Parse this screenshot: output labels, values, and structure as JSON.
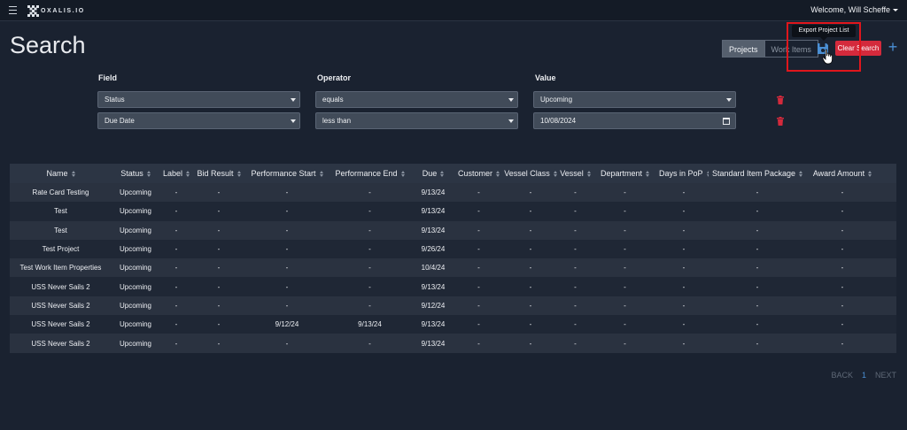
{
  "topbar": {
    "brand": "OXALIS.IO",
    "welcome": "Welcome, Will Scheffe"
  },
  "page": {
    "title": "Search"
  },
  "toolbar": {
    "projects_label": "Projects",
    "work_items_label": "Work Items",
    "clear_search_label": "Clear Search",
    "export_tooltip": "Export Project List",
    "plus_label": "+"
  },
  "filters": {
    "field_header": "Field",
    "operator_header": "Operator",
    "value_header": "Value",
    "rows": [
      {
        "field": "Status",
        "operator": "equals",
        "value": "Upcoming"
      },
      {
        "field": "Due Date",
        "operator": "less than",
        "value": "10/08/2024"
      }
    ]
  },
  "table": {
    "columns": [
      "Name",
      "Status",
      "Label",
      "Bid Result",
      "Performance Start",
      "Performance End",
      "Due",
      "Customer",
      "Vessel Class",
      "Vessel",
      "Department",
      "Days in PoP",
      "Standard Item Package",
      "Award Amount"
    ],
    "rows": [
      [
        "Rate Card Testing",
        "Upcoming",
        "-",
        "-",
        "-",
        "-",
        "9/13/24",
        "-",
        "-",
        "-",
        "-",
        "-",
        "-",
        "-"
      ],
      [
        "Test",
        "Upcoming",
        "-",
        "-",
        "-",
        "-",
        "9/13/24",
        "-",
        "-",
        "-",
        "-",
        "-",
        "-",
        "-"
      ],
      [
        "Test",
        "Upcoming",
        "-",
        "-",
        "-",
        "-",
        "9/13/24",
        "-",
        "-",
        "-",
        "-",
        "-",
        "-",
        "-"
      ],
      [
        "Test Project",
        "Upcoming",
        "-",
        "-",
        "-",
        "-",
        "9/26/24",
        "-",
        "-",
        "-",
        "-",
        "-",
        "-",
        "-"
      ],
      [
        "Test Work Item Properties",
        "Upcoming",
        "-",
        "-",
        "-",
        "-",
        "10/4/24",
        "-",
        "-",
        "-",
        "-",
        "-",
        "-",
        "-"
      ],
      [
        "USS Never Sails 2",
        "Upcoming",
        "-",
        "-",
        "-",
        "-",
        "9/13/24",
        "-",
        "-",
        "-",
        "-",
        "-",
        "-",
        "-"
      ],
      [
        "USS Never Sails 2",
        "Upcoming",
        "-",
        "-",
        "-",
        "-",
        "9/12/24",
        "-",
        "-",
        "-",
        "-",
        "-",
        "-",
        "-"
      ],
      [
        "USS Never Sails 2",
        "Upcoming",
        "-",
        "-",
        "9/12/24",
        "9/13/24",
        "9/13/24",
        "-",
        "-",
        "-",
        "-",
        "-",
        "-",
        "-"
      ],
      [
        "USS Never Sails 2",
        "Upcoming",
        "-",
        "-",
        "-",
        "-",
        "9/13/24",
        "-",
        "-",
        "-",
        "-",
        "-",
        "-",
        "-"
      ]
    ]
  },
  "pagination": {
    "back": "BACK",
    "page": "1",
    "next": "NEXT"
  },
  "icons": {
    "menu": "hamburger-icon",
    "logo": "oxalis-logo-icon",
    "save": "floppy-disk-icon",
    "trash": "trash-icon",
    "calendar": "calendar-icon",
    "cursor": "hand-pointer-icon"
  },
  "colors": {
    "background": "#1a2230",
    "topbar": "#141b26",
    "accent_blue": "#4a8fd4",
    "danger_red": "#d42a3c",
    "highlight_red": "#e0161c"
  }
}
